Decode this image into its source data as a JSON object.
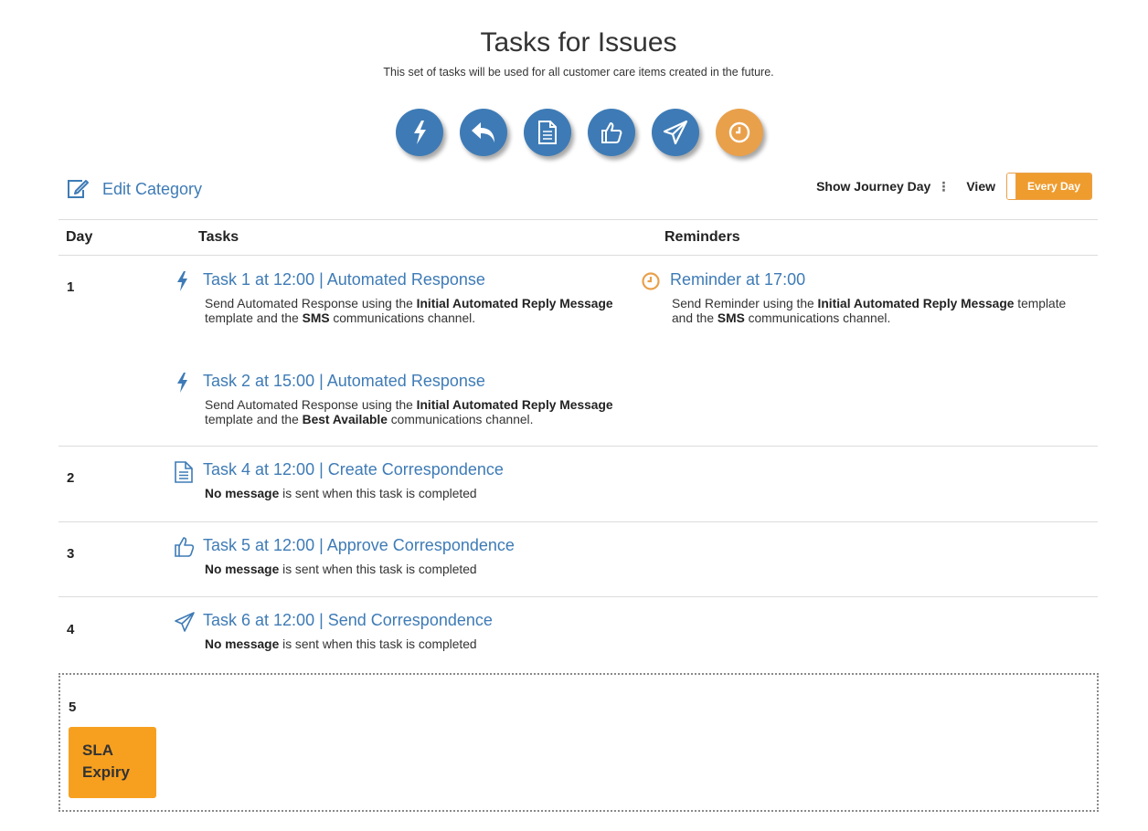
{
  "header": {
    "title": "Tasks for Issues",
    "subtitle": "This set of tasks will be used for all customer care items created in the future."
  },
  "task_types": [
    {
      "icon": "bolt-icon",
      "color": "#3e7bb6"
    },
    {
      "icon": "reply-icon",
      "color": "#3e7bb6"
    },
    {
      "icon": "document-icon",
      "color": "#3e7bb6"
    },
    {
      "icon": "thumbs-up-icon",
      "color": "#3e7bb6"
    },
    {
      "icon": "paper-plane-icon",
      "color": "#3e7bb6"
    },
    {
      "icon": "clock-icon",
      "color": "#e9a04b"
    }
  ],
  "toolbar": {
    "edit_category": "Edit Category",
    "show_journey_day": "Show Journey Day",
    "view_label": "View",
    "view_value": "Every Day"
  },
  "table": {
    "headers": {
      "day": "Day",
      "tasks": "Tasks",
      "reminders": "Reminders"
    },
    "rows": [
      {
        "day": "1",
        "tasks": [
          {
            "icon": "bolt-icon",
            "title": "Task 1 at 12:00 | Automated Response",
            "desc": {
              "pre": "Send Automated Response using the ",
              "template": "Initial Automated Reply Message",
              "mid": " template and the ",
              "channel": "SMS",
              "post": " communications channel."
            }
          },
          {
            "icon": "bolt-icon",
            "title": "Task 2 at 15:00 | Automated Response",
            "desc": {
              "pre": "Send Automated Response using the ",
              "template": "Initial Automated Reply Message",
              "mid": " template and the ",
              "channel": "Best Available",
              "post": " communications channel."
            }
          }
        ],
        "reminders": [
          {
            "icon": "clock-icon",
            "title": "Reminder at 17:00",
            "desc": {
              "pre": "Send Reminder using the ",
              "template": "Initial Automated Reply Message",
              "mid": " template and the ",
              "channel": "SMS",
              "post": " communications channel."
            }
          }
        ]
      },
      {
        "day": "2",
        "tasks": [
          {
            "icon": "document-icon",
            "title": "Task 4 at 12:00 | Create Correspondence",
            "desc": {
              "strong": "No message",
              "post": " is sent when this task is completed"
            }
          }
        ]
      },
      {
        "day": "3",
        "tasks": [
          {
            "icon": "thumbs-up-icon",
            "title": "Task 5 at 12:00 | Approve Correspondence",
            "desc": {
              "strong": "No message",
              "post": " is sent when this task is completed"
            }
          }
        ]
      },
      {
        "day": "4",
        "tasks": [
          {
            "icon": "paper-plane-icon",
            "title": "Task 6 at 12:00 | Send Correspondence",
            "desc": {
              "strong": "No message",
              "post": " is sent when this task is completed"
            }
          }
        ]
      },
      {
        "day": "5",
        "sla": {
          "line1": "SLA",
          "line2": "Expiry",
          "color": "#f7a01f"
        }
      }
    ]
  }
}
